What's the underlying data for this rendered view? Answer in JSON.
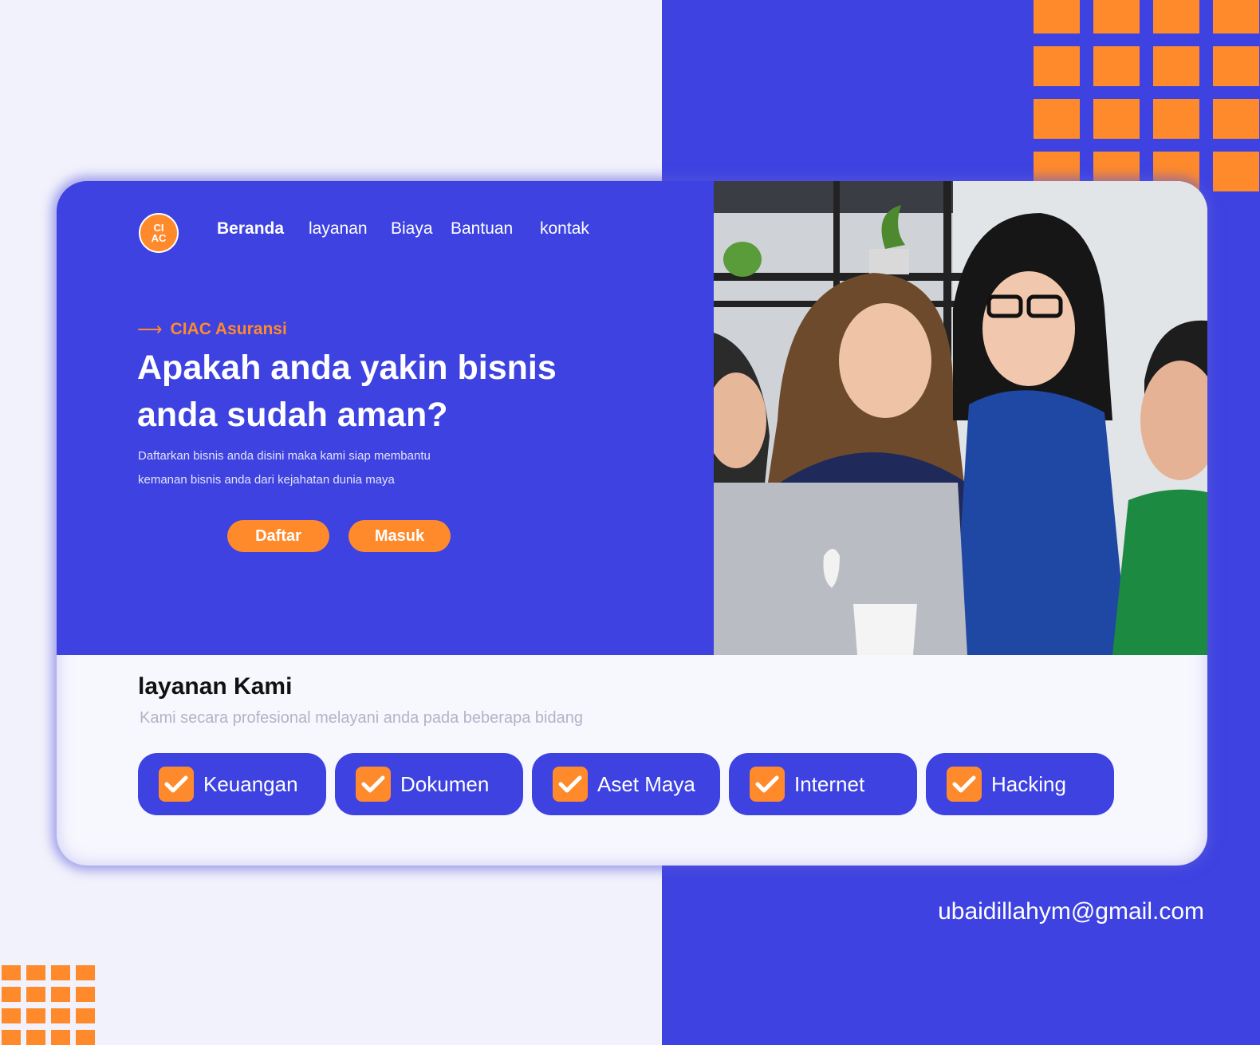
{
  "brand": {
    "logo_top": "CI",
    "logo_bottom": "AC"
  },
  "nav": {
    "items": [
      {
        "label": "Beranda",
        "active": true
      },
      {
        "label": "layanan",
        "active": false
      },
      {
        "label": "Biaya",
        "active": false
      },
      {
        "label": "Bantuan",
        "active": false
      },
      {
        "label": "kontak",
        "active": false
      }
    ]
  },
  "hero": {
    "tagline": "CIAC Asuransi",
    "headline": "Apakah anda yakin bisnis anda sudah aman?",
    "subtext": "Daftarkan bisnis anda disini maka kami siap membantu kemanan bisnis anda dari kejahatan dunia maya",
    "buttons": {
      "register": "Daftar",
      "login": "Masuk"
    }
  },
  "services": {
    "title": "layanan Kami",
    "subtitle": "Kami secara profesional  melayani anda pada beberapa bidang",
    "items": [
      "Keuangan",
      "Dokumen",
      "Aset Maya",
      "Internet",
      "Hacking"
    ]
  },
  "footer": {
    "email": "ubaidillahym@gmail.com"
  },
  "colors": {
    "primary": "#3d42e1",
    "accent": "#ff8a2c",
    "background": "#f2f2fc"
  }
}
